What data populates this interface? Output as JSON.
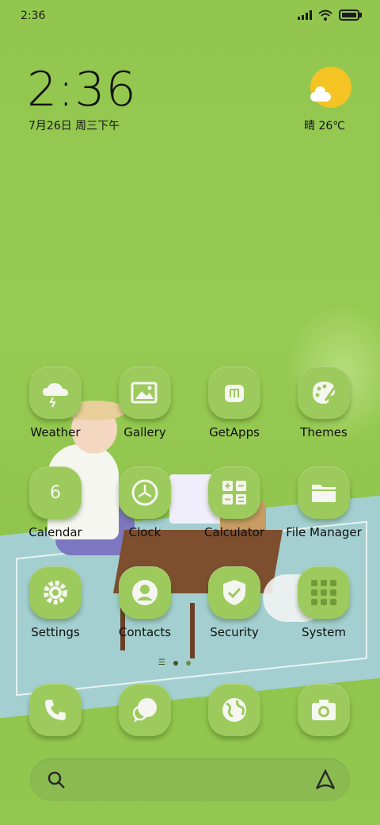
{
  "status_bar": {
    "time": "2:36"
  },
  "clock_widget": {
    "time": "2:36",
    "date": "7月26日 周三下午"
  },
  "weather_widget": {
    "text": "晴 26℃"
  },
  "apps": [
    {
      "label": "Weather",
      "icon": "weather-icon"
    },
    {
      "label": "Gallery",
      "icon": "gallery-icon"
    },
    {
      "label": "GetApps",
      "icon": "getapps-icon"
    },
    {
      "label": "Themes",
      "icon": "themes-icon"
    },
    {
      "label": "Calendar",
      "icon": "calendar-icon",
      "badge": "6"
    },
    {
      "label": "Clock",
      "icon": "clock-icon"
    },
    {
      "label": "Calculator",
      "icon": "calculator-icon"
    },
    {
      "label": "File Manager",
      "icon": "file-manager-icon"
    },
    {
      "label": "Settings",
      "icon": "settings-icon"
    },
    {
      "label": "Contacts",
      "icon": "contacts-icon"
    },
    {
      "label": "Security",
      "icon": "security-icon"
    },
    {
      "label": "System",
      "icon": "system-icon"
    }
  ],
  "pager": {
    "pages": 2,
    "current": 1
  },
  "dock": [
    {
      "icon": "phone-icon"
    },
    {
      "icon": "messages-icon"
    },
    {
      "icon": "browser-icon"
    },
    {
      "icon": "camera-icon"
    }
  ],
  "search_bar": {
    "search_icon": "search-icon",
    "assistant_icon": "assistant-icon"
  },
  "colors": {
    "icon_bg": "#9cca5c",
    "wallpaper": "#92c64e",
    "icon_glyph": "#f6f6f0"
  }
}
